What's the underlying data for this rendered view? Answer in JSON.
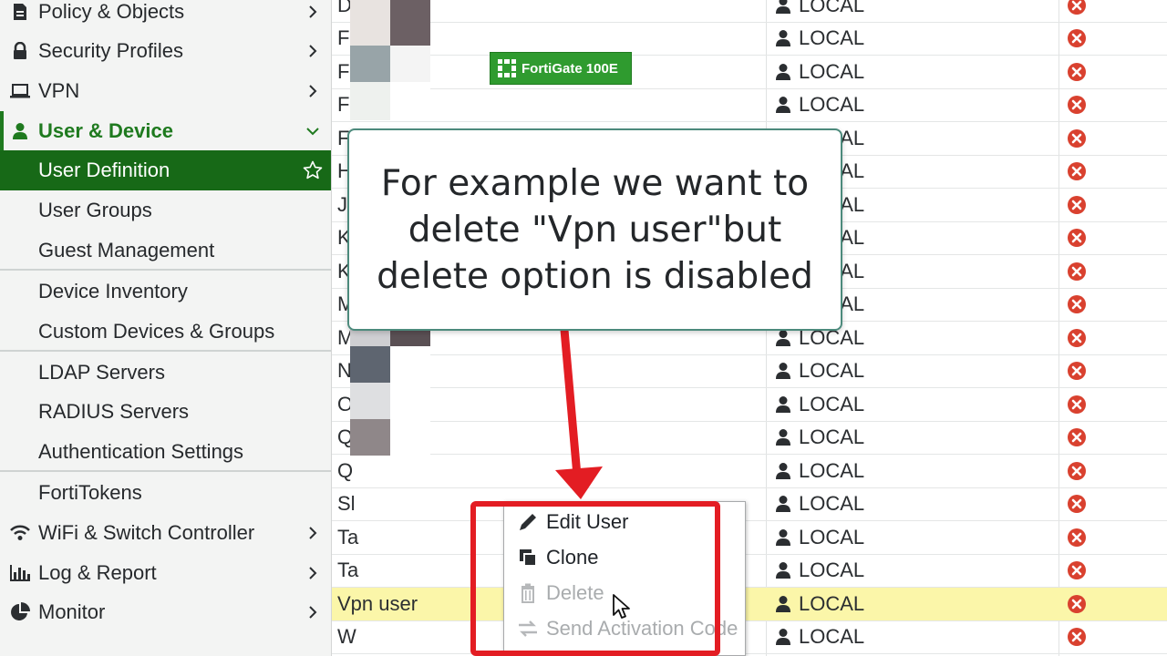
{
  "sidebar": {
    "items": [
      {
        "label": "Policy & Objects",
        "icon": "document-icon"
      },
      {
        "label": "Security Profiles",
        "icon": "lock-icon"
      },
      {
        "label": "VPN",
        "icon": "laptop-icon"
      },
      {
        "label": "User & Device",
        "icon": "user-icon"
      },
      {
        "label": "User Definition"
      },
      {
        "label": "User Groups"
      },
      {
        "label": "Guest Management"
      },
      {
        "label": "Device Inventory"
      },
      {
        "label": "Custom Devices & Groups"
      },
      {
        "label": "LDAP Servers"
      },
      {
        "label": "RADIUS Servers"
      },
      {
        "label": "Authentication Settings"
      },
      {
        "label": "FortiTokens"
      },
      {
        "label": "WiFi & Switch Controller",
        "icon": "wifi-icon"
      },
      {
        "label": "Log & Report",
        "icon": "bar-chart-icon"
      },
      {
        "label": "Monitor",
        "icon": "pie-chart-icon"
      }
    ]
  },
  "badge": {
    "label": "FortiGate 100E"
  },
  "callout": {
    "text": "For example we want to delete \"Vpn user\"but delete option is disabled"
  },
  "table": {
    "rows": [
      {
        "name": "D",
        "type": "LOCAL"
      },
      {
        "name": "Fa",
        "type": "LOCAL"
      },
      {
        "name": "Fa",
        "type": "LOCAL"
      },
      {
        "name": "Fa",
        "type": "LOCAL"
      },
      {
        "name": "F",
        "type": "LOCAL"
      },
      {
        "name": "H",
        "type": "LOCAL"
      },
      {
        "name": "J",
        "type": "LOCAL"
      },
      {
        "name": "K",
        "type": "LOCAL"
      },
      {
        "name": "K",
        "type": "LOCAL"
      },
      {
        "name": "M",
        "type": "LOCAL"
      },
      {
        "name": "M",
        "type": "LOCAL"
      },
      {
        "name": "N",
        "type": "LOCAL"
      },
      {
        "name": "O",
        "type": "LOCAL"
      },
      {
        "name": "Q",
        "type": "LOCAL"
      },
      {
        "name": "Q",
        "type": "LOCAL"
      },
      {
        "name": "Sl",
        "type": "LOCAL"
      },
      {
        "name": "Ta",
        "type": "LOCAL"
      },
      {
        "name": "Ta",
        "type": "LOCAL"
      },
      {
        "name": "Vpn user",
        "type": "LOCAL"
      },
      {
        "name": "W",
        "type": "LOCAL"
      }
    ]
  },
  "menu": {
    "edit": "Edit User",
    "clone": "Clone",
    "delete": "Delete",
    "send": "Send Activation Code"
  },
  "colors": {
    "brand_green": "#176917",
    "status_red": "#d9412f",
    "highlight_yellow": "#fbf6a9",
    "annotation_red": "#e31d23"
  }
}
